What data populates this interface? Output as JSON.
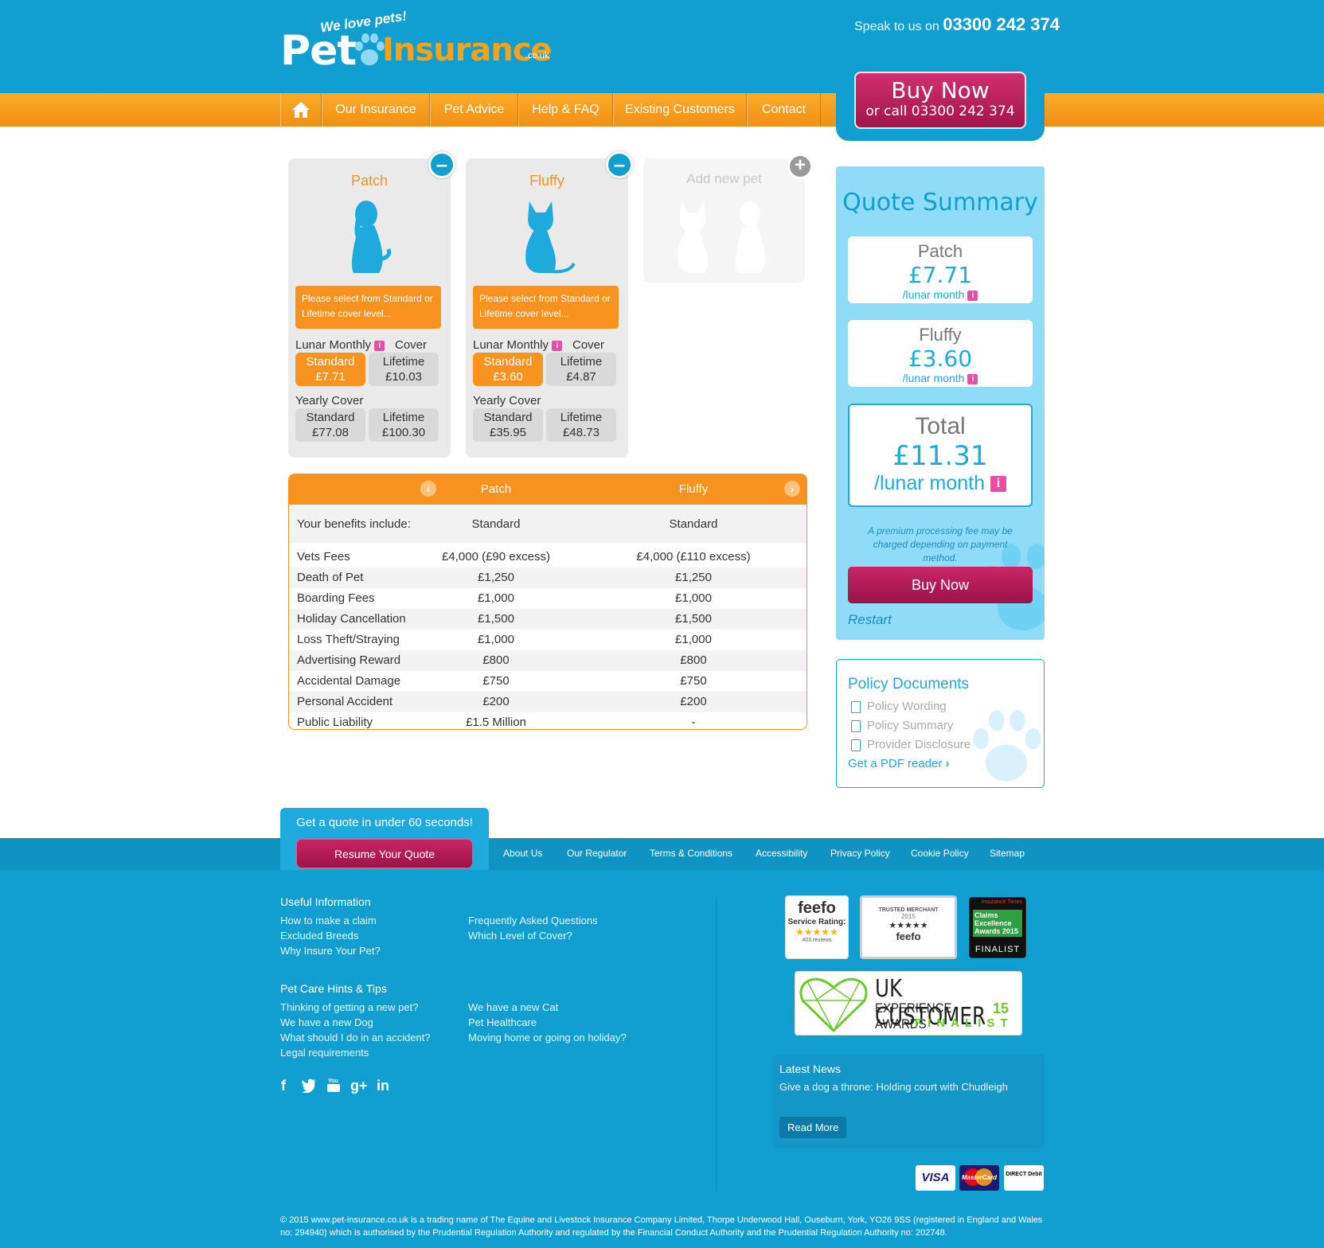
{
  "header": {
    "logo_tagline": "We love pets!",
    "logo_pet": "Pet",
    "logo_insurance": "Insurance",
    "logo_couk": ".co.uk",
    "speak_label": "Speak to us on",
    "phone": "03300 242 374"
  },
  "nav": {
    "home_icon": "home-icon",
    "items": [
      "Our Insurance",
      "Pet Advice",
      "Help & FAQ",
      "Existing Customers",
      "Contact"
    ]
  },
  "buy_now": {
    "line1": "Buy Now",
    "line2": "or call 03300 242 374"
  },
  "pets": [
    {
      "name": "Patch",
      "icon": "dog-icon",
      "warning": "Please select from Standard or Lifetime cover level...",
      "lunar_label": "Lunar Monthly",
      "cover_label": "Cover",
      "lunar_standard": {
        "label": "Standard",
        "price": "£7.71"
      },
      "lunar_lifetime": {
        "label": "Lifetime",
        "price": "£10.03"
      },
      "yearly_label": "Yearly Cover",
      "yearly_standard": {
        "label": "Standard",
        "price": "£77.08"
      },
      "yearly_lifetime": {
        "label": "Lifetime",
        "price": "£100.30"
      }
    },
    {
      "name": "Fluffy",
      "icon": "cat-icon",
      "warning": "Please select from Standard or Lifetime cover level...",
      "lunar_label": "Lunar Monthly",
      "cover_label": "Cover",
      "lunar_standard": {
        "label": "Standard",
        "price": "£3.60"
      },
      "lunar_lifetime": {
        "label": "Lifetime",
        "price": "£4.87"
      },
      "yearly_label": "Yearly Cover",
      "yearly_standard": {
        "label": "Standard",
        "price": "£35.95"
      },
      "yearly_lifetime": {
        "label": "Lifetime",
        "price": "£48.73"
      }
    }
  ],
  "add_pet": {
    "label": "Add new pet"
  },
  "benefits": {
    "col1": "Patch",
    "col2": "Fluffy",
    "intro": "Your benefits include:",
    "level1": "Standard",
    "level2": "Standard",
    "rows": [
      [
        "Vets Fees",
        "£4,000 (£90 excess)",
        "£4,000 (£110 excess)"
      ],
      [
        "Death of Pet",
        "£1,250",
        "£1,250"
      ],
      [
        "Boarding Fees",
        "£1,000",
        "£1,000"
      ],
      [
        "Holiday Cancellation",
        "£1,500",
        "£1,500"
      ],
      [
        "Loss Theft/Straying",
        "£1,000",
        "£1,000"
      ],
      [
        "Advertising Reward",
        "£800",
        "£800"
      ],
      [
        "Accidental Damage",
        "£750",
        "£750"
      ],
      [
        "Personal Accident",
        "£200",
        "£200"
      ],
      [
        "Public Liability",
        "£1.5 Million",
        "-"
      ]
    ]
  },
  "quote_summary": {
    "title": "Quote Summary",
    "items": [
      {
        "name": "Patch",
        "price": "£7.71",
        "unit": "/lunar month"
      },
      {
        "name": "Fluffy",
        "price": "£3.60",
        "unit": "/lunar month"
      }
    ],
    "total_label": "Total",
    "total_price": "£11.31",
    "total_unit": "/lunar month",
    "fee_note": "A premium processing fee may be charged depending on payment method.",
    "buy_label": "Buy Now",
    "restart_label": "Restart"
  },
  "policy_docs": {
    "title": "Policy Documents",
    "items": [
      "Policy Wording",
      "Policy Summary",
      "Provider Disclosure"
    ],
    "pdf_link": "Get a PDF reader"
  },
  "footer": {
    "quote_tab": "Get a quote in under 60 seconds!",
    "resume": "Resume Your Quote",
    "links": [
      "About Us",
      "Our Regulator",
      "Terms & Conditions",
      "Accessibility",
      "Privacy Policy",
      "Cookie Policy",
      "Sitemap"
    ],
    "useful_title": "Useful Information",
    "useful_col1": [
      "How to make a claim",
      "Excluded Breeds",
      "Why Insure Your Pet?"
    ],
    "useful_col2": [
      "Frequently Asked Questions",
      "Which Level of Cover?"
    ],
    "tips_title": "Pet Care Hints & Tips",
    "tips_col1": [
      "Thinking of getting a new pet?",
      "We have a new Dog",
      "What should I do in an accident?",
      "Legal requirements"
    ],
    "tips_col2": [
      "We have a new Cat",
      "Pet Healthcare",
      "Moving home or going on holiday?"
    ],
    "social": [
      "facebook-icon",
      "twitter-icon",
      "youtube-icon",
      "google-plus-icon",
      "linkedin-icon"
    ],
    "feefo": {
      "brand": "feefo",
      "rating_label": "Service Rating:",
      "reviews": "403 reviews"
    },
    "trusted": {
      "label": "TRUSTED MERCHANT",
      "year": "2015",
      "brand": "feefo"
    },
    "insurance_times": {
      "line1": "Insurance Times",
      "line2": "Claims Excellence Awards 2015",
      "line3": "FINALIST"
    },
    "ukcx": {
      "line1": "UK CUSTOMER",
      "line2": "EXPERIENCE AWARDS",
      "year": "15",
      "line3": "FINALIST"
    },
    "news_title": "Latest News",
    "news_text": "Give a dog a throne: Holding court with Chudleigh",
    "read_more": "Read More",
    "payments": [
      "VISA",
      "MasterCard",
      "DIRECT Debit"
    ],
    "copyright": "© 2015 www.pet-insurance.co.uk is a trading name of The Equine and Livestock Insurance Company Limited, Thorpe Underwood Hall, Ouseburn, York, YO26 9SS (registered in England and Wales no: 294940) which is authorised by the Prudential Regulation Authority and regulated by the Financial Conduct Authority and the Prudential Regulation Authority no: 202748."
  },
  "colors": {
    "blue": "#119fd2",
    "orange": "#f7931e",
    "magenta": "#a3154a",
    "light_blue": "#8edcf7"
  }
}
